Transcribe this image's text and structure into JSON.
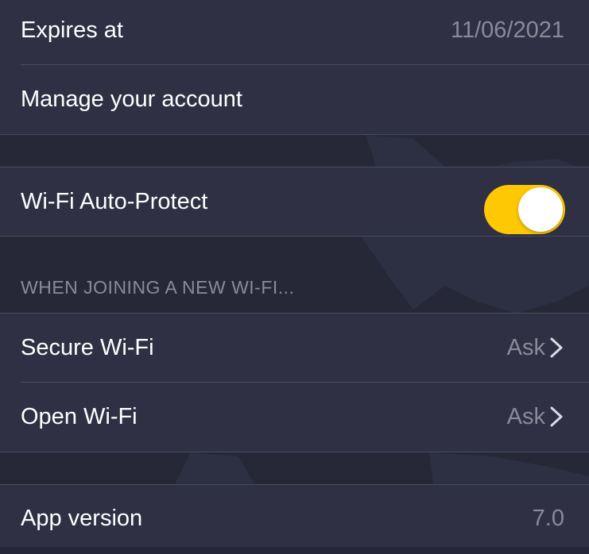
{
  "colors": {
    "background": "#262838",
    "row_background": "#2f3044",
    "separator": "#4a4b5c",
    "label_text": "#ffffff",
    "value_text": "#8a8b98",
    "toggle_on": "#fec804"
  },
  "account": {
    "expires_label": "Expires at",
    "expires_value": "11/06/2021",
    "manage_label": "Manage your account"
  },
  "wifi_auto_protect": {
    "label": "Wi-Fi Auto-Protect",
    "enabled": true
  },
  "new_wifi_section": {
    "header": "WHEN JOINING A NEW WI-FI...",
    "items": [
      {
        "label": "Secure Wi-Fi",
        "value": "Ask",
        "icon": "chevron-right-icon"
      },
      {
        "label": "Open Wi-Fi",
        "value": "Ask",
        "icon": "chevron-right-icon"
      }
    ]
  },
  "about": {
    "version_label": "App version",
    "version_value": "7.0"
  }
}
